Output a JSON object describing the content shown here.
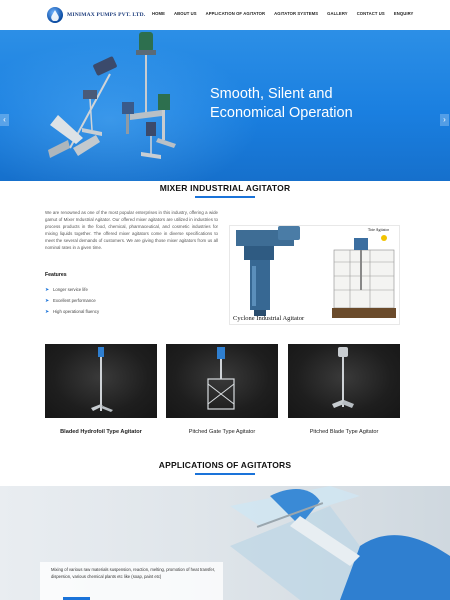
{
  "header": {
    "logo_text": "MINIMAX PUMPS PVT. LTD.",
    "nav": [
      "HOME",
      "ABOUT US",
      "APPLICATION OF AGITATOR",
      "AGITATOR SYSTEMS",
      "GALLERY",
      "CONTACT US",
      "ENQUIRY"
    ]
  },
  "hero": {
    "title_line1": "Smooth, Silent and",
    "title_line2": "Economical Operation",
    "prev_icon": "chevron-left-icon",
    "next_icon": "chevron-right-icon"
  },
  "about": {
    "title": "MIXER INDUSTRIAL AGITATOR",
    "paragraph": "We are renowned as one of the most popular enterprises in this industry, offering a wide gamut of Mixer Industrial Agitator. Our offered mixer agitators are utilized in industries to process products in the food, chemical, pharmaceutical, and cosmetic industries for mixing liquids together. The offered mixer agitators come in diverse specifications to meet the several demands of customers. We are giving those mixer agitators from us all nominal rates in a given time.",
    "features_heading": "Features",
    "features": [
      "Longer service life",
      "Excellent performance",
      "High operational fluency"
    ],
    "photo_caption": "Cyclone Industrial Agitator",
    "photo_tag": "Tote Agitator"
  },
  "products": [
    {
      "label": "Bladed Hydrofoil Type Agitator"
    },
    {
      "label": "Pitched Gate Type Agitator"
    },
    {
      "label": "Pitched Blade Type Agitator"
    }
  ],
  "applications": {
    "title": "APPLICATIONS OF AGITATORS",
    "text": "Mixing of various raw materials suspension, reaction, melting, promotion of heat transfer, dispersion, various chemical plants etc like (soap, paint etc)"
  },
  "colors": {
    "accent": "#1a73d9",
    "hero_blue": "#1a7fe0"
  }
}
